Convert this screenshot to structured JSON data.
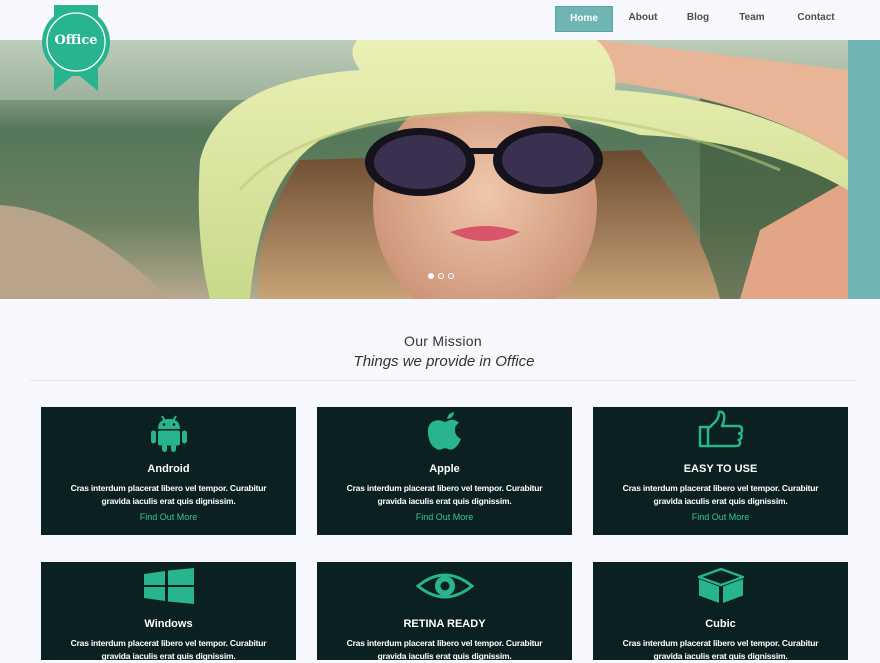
{
  "brand": {
    "logo_text": "Office",
    "accent": "#27b48f",
    "teal": "#6fb5b4",
    "card_bg": "#0b2020",
    "link_color": "#3ec1a5"
  },
  "nav": {
    "items": [
      {
        "label": "Home",
        "active": true
      },
      {
        "label": "About",
        "active": false
      },
      {
        "label": "Blog",
        "active": false
      },
      {
        "label": "Team",
        "active": false
      },
      {
        "label": "Contact",
        "active": false
      }
    ]
  },
  "hero": {
    "slide_count": 3,
    "active_slide": 1
  },
  "mission": {
    "title": "Our Mission",
    "subtitle": "Things we provide in Office"
  },
  "features": [
    {
      "icon": "android-icon",
      "title": "Android",
      "desc_line1": "Cras interdum placerat libero vel tempor. Curabitur",
      "desc_line2": "gravida iaculis erat quis dignissim.",
      "link": "Find Out More"
    },
    {
      "icon": "apple-icon",
      "title": "Apple",
      "desc_line1": "Cras interdum placerat libero vel tempor. Curabitur",
      "desc_line2": "gravida iaculis erat quis dignissim.",
      "link": "Find Out More"
    },
    {
      "icon": "thumbs-up-icon",
      "title": "EASY TO USE",
      "desc_line1": "Cras interdum placerat libero vel tempor. Curabitur",
      "desc_line2": "gravida iaculis erat quis dignissim.",
      "link": "Find Out More"
    },
    {
      "icon": "windows-icon",
      "title": "Windows",
      "desc_line1": "Cras interdum placerat libero vel tempor. Curabitur",
      "desc_line2": "gravida iaculis erat quis dignissim.",
      "link": ""
    },
    {
      "icon": "eye-icon",
      "title": "RETINA READY",
      "desc_line1": "Cras interdum placerat libero vel tempor. Curabitur",
      "desc_line2": "gravida iaculis erat quis dignissim.",
      "link": ""
    },
    {
      "icon": "cube-icon",
      "title": "Cubic",
      "desc_line1": "Cras interdum placerat libero vel tempor. Curabitur",
      "desc_line2": "gravida iaculis erat quis dignissim.",
      "link": ""
    }
  ]
}
